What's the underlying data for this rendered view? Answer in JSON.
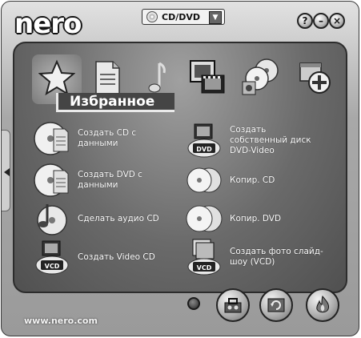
{
  "app": {
    "logo": "nero",
    "site": "www.nero.com"
  },
  "selector": {
    "value": "CD/DVD",
    "arrow": "▼"
  },
  "window_controls": {
    "help": "?",
    "minimize": "–",
    "close": "×"
  },
  "category": {
    "title": "Избранное"
  },
  "tabs": [
    {
      "id": "favorites",
      "icon": "star-icon"
    },
    {
      "id": "data",
      "icon": "document-icon"
    },
    {
      "id": "music",
      "icon": "music-note-icon"
    },
    {
      "id": "video",
      "icon": "film-icon"
    },
    {
      "id": "copy-backup",
      "icon": "discs-icon"
    },
    {
      "id": "extras",
      "icon": "add-icon"
    }
  ],
  "tasks_left": [
    {
      "label": "Создать CD с\nданными",
      "icon": "data-disc-icon"
    },
    {
      "label": "Создать DVD с\nданными",
      "icon": "data-disc-icon"
    },
    {
      "label": "Сделать аудио CD",
      "icon": "audio-disc-icon"
    },
    {
      "label": "Создать Video CD",
      "icon": "vcd-icon"
    }
  ],
  "tasks_right": [
    {
      "label": "Создать\nсобственный диск\nDVD-Video",
      "icon": "dvd-video-icon",
      "badge": "DVD"
    },
    {
      "label": "Копир. CD",
      "icon": "copy-cd-icon"
    },
    {
      "label": "Копир. DVD",
      "icon": "copy-dvd-icon"
    },
    {
      "label": "Создать фото слайд-\nшоу (VCD)",
      "icon": "photo-vcd-icon",
      "badge": "VCD"
    }
  ],
  "vcd_badge": "VCD"
}
